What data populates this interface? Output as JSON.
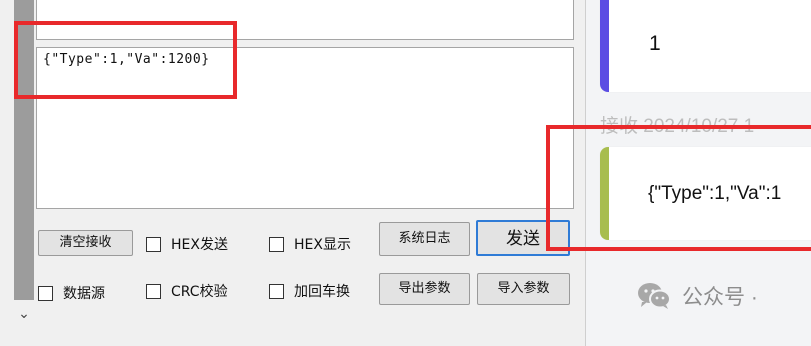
{
  "serial_tool": {
    "send_text": "{\"Type\":1,\"Va\":1200}",
    "buttons": {
      "clear_receive": "清空接收",
      "system_log": "系统日志",
      "send": "发送",
      "export_params": "导出参数",
      "import_params": "导入参数"
    },
    "checkboxes": {
      "hex_send": "HEX发送",
      "hex_display": "HEX显示",
      "data_source": "数据源",
      "crc_check": "CRC校验",
      "crlf": "加回车换"
    }
  },
  "chat": {
    "bubble_sent": "1",
    "receive_label": "接收  2024/10/27 1",
    "bubble_received": "{\"Type\":1,\"Va\":1",
    "accent_colors": {
      "sent": "#5b4de3",
      "received": "#a8bd4e"
    }
  },
  "watermark": {
    "text": "公众号 ·",
    "icon": "wechat-icon"
  },
  "annotation_color": "#e8292b"
}
